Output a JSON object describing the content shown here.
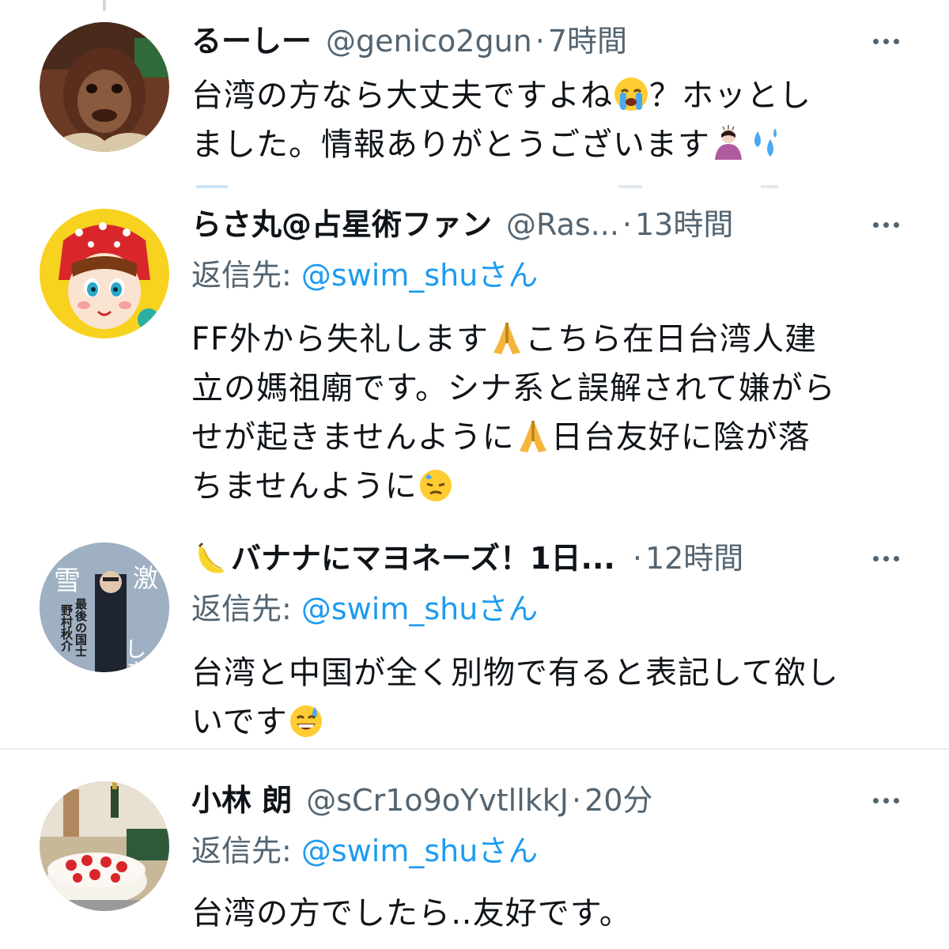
{
  "tweets": [
    {
      "name": "るーしー",
      "handle": "@genico2gun",
      "sep": "·",
      "time": "7時間",
      "body_lines": [
        "台湾の方なら大丈夫ですよね",
        "？ホッとし",
        "ました。情報ありがとうございます"
      ],
      "avatar": "orangutan-avatar"
    },
    {
      "name": "らさ丸@占星術ファン",
      "handle": "@Ras...",
      "sep": "·",
      "time": "13時間",
      "reply_prefix": "返信先: ",
      "reply_mention": "@swim_shuさん",
      "body_lines": [
        "FF外から失礼します",
        "こちら在日台湾人建",
        "立の媽祖廟です。シナ系と誤解されて嫌がら",
        "せが起きませんように",
        "日台友好に陰が落",
        "ちませんように"
      ],
      "avatar": "cartoon-girl-avatar"
    },
    {
      "name": "バナナにマヨネーズ！1日...",
      "sep": "·",
      "time": "12時間",
      "reply_prefix": "返信先: ",
      "reply_mention": "@swim_shuさん",
      "body_lines": [
        "台湾と中国が全く別物で有ると表記して欲し",
        "いです"
      ],
      "avatar_texts": [
        "雪",
        "激",
        "しき",
        "最後の国士",
        "野村秋介"
      ],
      "avatar": "book-cover-avatar"
    },
    {
      "name": "小林 朗",
      "handle": "@sCr1o9oYvtllkkJ",
      "sep": "·",
      "time": "20分",
      "reply_prefix": "返信先: ",
      "reply_mention": "@swim_shuさん",
      "body_lines": [
        "台湾の方でしたら‥友好です。"
      ],
      "avatar": "cake-avatar"
    }
  ],
  "icons": {
    "more": "more-options-icon",
    "crying": "loudly-crying-face-icon",
    "bowing": "person-bowing-icon",
    "sweat": "sweat-droplets-icon",
    "pray": "folded-hands-icon",
    "downcast": "downcast-face-with-sweat-icon",
    "banana": "banana-icon",
    "grin_sweat": "grinning-face-with-sweat-icon"
  },
  "colors": {
    "text": "#0f1419",
    "secondary": "#536471",
    "link": "#1d9bf0",
    "divider": "#e6ecf0"
  }
}
